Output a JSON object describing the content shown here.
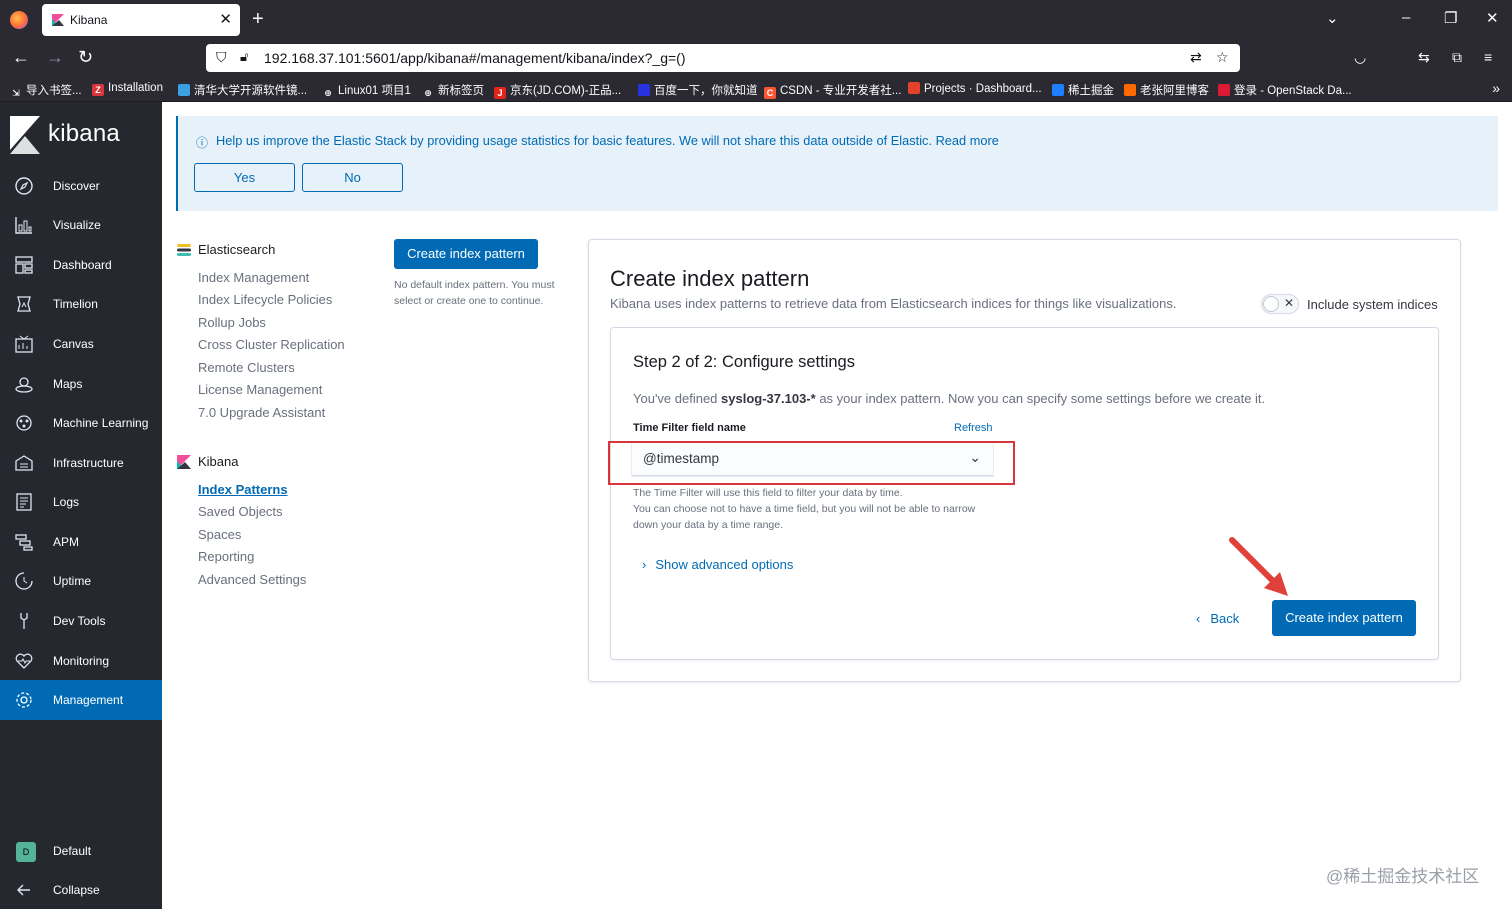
{
  "browser": {
    "tab_title": "Kibana",
    "url": "192.168.37.101:5601/app/kibana#/management/kibana/index?_g=()",
    "bookmarks": [
      "导入书签...",
      "Installation",
      "清华大学开源软件镜...",
      "Linux01 项目1",
      "新标签页",
      "京东(JD.COM)-正品...",
      "百度一下，你就知道",
      "CSDN - 专业开发者社...",
      "Projects · Dashboard...",
      "稀土掘金",
      "老张阿里博客",
      "登录 - OpenStack Da..."
    ]
  },
  "sidebar": {
    "logo_text": "kibana",
    "items": [
      {
        "label": "Discover",
        "icon": "compass-icon"
      },
      {
        "label": "Visualize",
        "icon": "visualize-icon"
      },
      {
        "label": "Dashboard",
        "icon": "dashboard-icon"
      },
      {
        "label": "Timelion",
        "icon": "timelion-icon"
      },
      {
        "label": "Canvas",
        "icon": "canvas-icon"
      },
      {
        "label": "Maps",
        "icon": "maps-icon"
      },
      {
        "label": "Machine Learning",
        "icon": "ml-icon"
      },
      {
        "label": "Infrastructure",
        "icon": "infrastructure-icon"
      },
      {
        "label": "Logs",
        "icon": "logs-icon"
      },
      {
        "label": "APM",
        "icon": "apm-icon"
      },
      {
        "label": "Uptime",
        "icon": "uptime-icon"
      },
      {
        "label": "Dev Tools",
        "icon": "wrench-icon"
      },
      {
        "label": "Monitoring",
        "icon": "monitoring-icon"
      },
      {
        "label": "Management",
        "icon": "gear-icon",
        "active": true
      }
    ],
    "space_badge": "D",
    "space_label": "Default",
    "collapse_label": "Collapse"
  },
  "callout": {
    "text": "Help us improve the Elastic Stack by providing usage statistics for basic features. We will not share this data outside of Elastic. Read more",
    "yes_label": "Yes",
    "no_label": "No"
  },
  "mgmt_nav": {
    "elasticsearch_title": "Elasticsearch",
    "elasticsearch_items": [
      "Index Management",
      "Index Lifecycle Policies",
      "Rollup Jobs",
      "Cross Cluster Replication",
      "Remote Clusters",
      "License Management",
      "7.0 Upgrade Assistant"
    ],
    "kibana_title": "Kibana",
    "kibana_items": [
      "Index Patterns",
      "Saved Objects",
      "Spaces",
      "Reporting",
      "Advanced Settings"
    ],
    "active_item": "Index Patterns"
  },
  "index_list": {
    "create_button": "Create index pattern",
    "note": "No default index pattern. You must select or create one to continue."
  },
  "create_panel": {
    "title": "Create index pattern",
    "description": "Kibana uses index patterns to retrieve data from Elasticsearch indices for things like visualizations.",
    "toggle_label": "Include system indices",
    "step_title": "Step 2 of 2: Configure settings",
    "step_desc_prefix": "You've defined ",
    "index_pattern": "syslog-37.103-*",
    "step_desc_suffix": " as your index pattern. Now you can specify some settings before we create it.",
    "field_label": "Time Filter field name",
    "refresh_label": "Refresh",
    "time_field_value": "@timestamp",
    "help_line1": "The Time Filter will use this field to filter your data by time.",
    "help_line2": "You can choose not to have a time field, but you will not be able to narrow down your data by a time range.",
    "advanced_label": "Show advanced options",
    "back_label": "Back",
    "create_label": "Create index pattern"
  },
  "watermark": "@稀土掘金技术社区",
  "colors": {
    "accent": "#006bb4",
    "sidebar_bg": "#25282f",
    "highlight_box": "#d9353c",
    "arrow": "#e0403a"
  }
}
